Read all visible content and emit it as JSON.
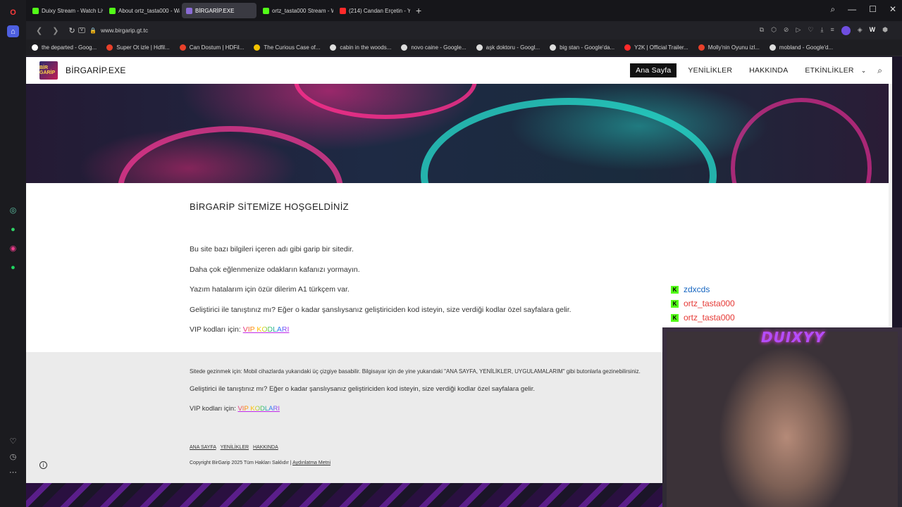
{
  "browser": {
    "tabs": [
      {
        "title": "Duixy Stream - Watch Live",
        "color": "#53fc18",
        "active": false
      },
      {
        "title": "About ortz_tasta000 - Wat",
        "color": "#53fc18",
        "active": false
      },
      {
        "title": "BİRGARİP.EXE",
        "color": "#8a6bd6",
        "active": true
      },
      {
        "title": "ortz_tasta000 Stream - Wa",
        "color": "#53fc18",
        "active": false
      },
      {
        "title": "(214) Candan Erçetin - Yo",
        "color": "#ff2a2a",
        "active": false
      }
    ],
    "new_tab": "+",
    "url": "www.birgarip.gt.tc",
    "bookmarks": [
      {
        "label": "the departed - Goog...",
        "color": "#ffffff"
      },
      {
        "label": "Super Ot izle | Hdfil...",
        "color": "#e8402a"
      },
      {
        "label": "Can Dostum | HDFil...",
        "color": "#e8402a"
      },
      {
        "label": "The Curious Case of...",
        "color": "#f2c200"
      },
      {
        "label": "cabin in the woods...",
        "color": "#ffffff"
      },
      {
        "label": "novo caine - Google...",
        "color": "#ffffff"
      },
      {
        "label": "aşk doktoru - Googl...",
        "color": "#ffffff"
      },
      {
        "label": "big stan - Google'da...",
        "color": "#ffffff"
      },
      {
        "label": "Y2K | Official Trailer...",
        "color": "#ff2a2a"
      },
      {
        "label": "Molly'nin Oyunu izl...",
        "color": "#e8402a"
      },
      {
        "label": "mobland - Google'd...",
        "color": "#ffffff"
      }
    ]
  },
  "site": {
    "logo_text": "BİR GARİP",
    "name": "BİRGARİP.EXE",
    "nav": [
      "Ana Sayfa",
      "YENİLİKLER",
      "HAKKINDA",
      "ETKİNLİKLER"
    ],
    "welcome": "BİRGARİP SİTEMİZE HOŞGELDİNİZ",
    "paragraphs": [
      "Bu site bazı bilgileri içeren adı gibi garip bir sitedir.",
      "Daha çok eğlenmenize odakların kafanızı yormayın.",
      "Yazım hatalarım için özür dilerim A1 türkçem var.",
      "Geliştirici ile tanıştınız mı? Eğer o kadar şanslıysanız geliştiriciden kod isteyin, size verdiği kodlar özel sayfalara gelir."
    ],
    "vip_label": "VIP kodları için:",
    "vip_link": "VIP KODLARI",
    "footer": {
      "note": "Sitede gezinmek için: Mobil cihazlarda yukarıdaki üç çizgiye basabilir. Bilgisayar için de yine yukarıdaki \"ANA SAYFA, YENİLİKLER, UYGULAMALARIM\" gibi butonlarla gezinebilirsiniz.",
      "dev": "Geliştirici ile tanıştınız mı? Eğer o kadar şanslıysanız geliştiriciden kod isteyin, size verdiği kodlar özel sayfalara gelir.",
      "vip_label": "VIP kodları için:",
      "vip_link": "VIP KODLARI",
      "links": [
        "ANA SAYFA",
        "YENİLİKLER",
        "HAKKINDA"
      ],
      "copyright": "Copyright BirGarip 2025 Tüm Hakları Saklıdır",
      "privacy": "Aydınlatma Metni"
    }
  },
  "stream": {
    "chat": [
      {
        "user": "zdxcds",
        "color": "#1565c0"
      },
      {
        "user": "ortz_tasta000",
        "color": "#e53935"
      },
      {
        "user": "ortz_tasta000",
        "color": "#e53935"
      }
    ],
    "webcam_label": "DUIXYY"
  }
}
